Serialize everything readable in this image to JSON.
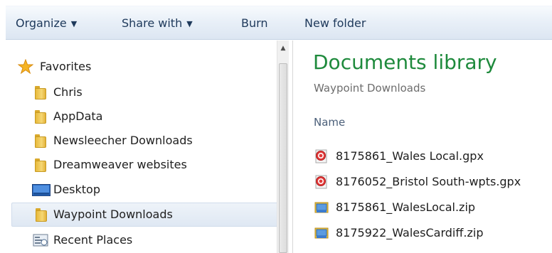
{
  "toolbar": {
    "organize": "Organize",
    "share_with": "Share with",
    "burn": "Burn",
    "new_folder": "New folder"
  },
  "nav": {
    "favorites": "Favorites",
    "items": [
      {
        "label": "Chris",
        "icon": "folder-icon"
      },
      {
        "label": "AppData",
        "icon": "folder-icon"
      },
      {
        "label": "Newsleecher Downloads",
        "icon": "folder-icon"
      },
      {
        "label": "Dreamweaver websites",
        "icon": "folder-icon"
      },
      {
        "label": "Desktop",
        "icon": "desktop-icon"
      },
      {
        "label": "Waypoint Downloads",
        "icon": "folder-icon",
        "selected": true
      },
      {
        "label": "Recent Places",
        "icon": "recent-places-icon"
      }
    ]
  },
  "content": {
    "library_title": "Documents library",
    "library_subtitle": "Waypoint Downloads",
    "column_name": "Name",
    "files": [
      {
        "name": "8175861_Wales Local.gpx",
        "icon": "gpx-file-icon"
      },
      {
        "name": "8176052_Bristol South-wpts.gpx",
        "icon": "gpx-file-icon"
      },
      {
        "name": "8175861_WalesLocal.zip",
        "icon": "zip-file-icon"
      },
      {
        "name": "8175922_WalesCardiff.zip",
        "icon": "zip-file-icon"
      }
    ]
  },
  "colors": {
    "library_title": "#1e8a3c",
    "toolbar_text": "#1e395b",
    "selection": "#dfe8f3"
  }
}
